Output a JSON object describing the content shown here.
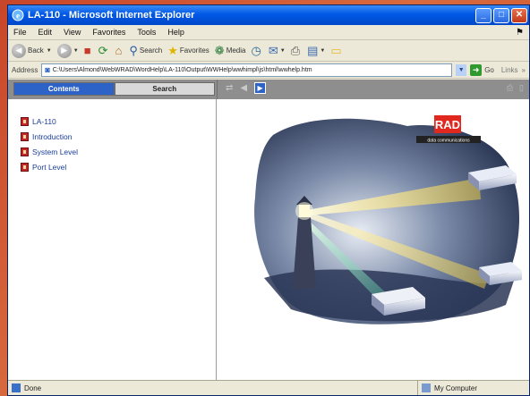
{
  "window": {
    "title": "LA-110 - Microsoft Internet Explorer"
  },
  "menu": [
    "File",
    "Edit",
    "View",
    "Favorites",
    "Tools",
    "Help"
  ],
  "toolbar": {
    "back": "Back",
    "search": "Search",
    "favorites": "Favorites",
    "media": "Media"
  },
  "address": {
    "label": "Address",
    "url": "C:\\Users\\Almond\\WebWRAD\\WordHelp\\LA-110\\Output\\WWHelp\\wwhimpl\\js\\html\\wwhelp.htm",
    "go": "Go",
    "links": "Links"
  },
  "help": {
    "tabs": {
      "contents": "Contents",
      "search": "Search"
    },
    "toc": [
      "LA-110",
      "Introduction",
      "System Level",
      "Port Level"
    ]
  },
  "illustration": {
    "logo_text": "RAD",
    "tagline": "data communications"
  },
  "status": {
    "left": "Done",
    "zone": "My Computer"
  },
  "colors": {
    "desktop": "#c8462a",
    "titlebar": "#0058e6",
    "tab_active": "#2d62c7",
    "help_bar": "#8e8e8e",
    "rad_red": "#e0281e"
  }
}
